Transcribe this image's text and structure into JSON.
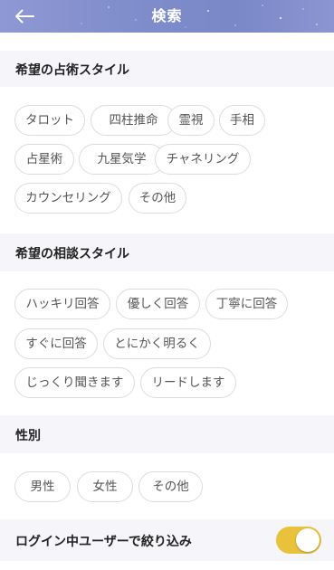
{
  "header": {
    "title": "検索",
    "back_icon": "arrow-left-icon"
  },
  "sections": [
    {
      "title": "希望の占術スタイル",
      "options": [
        "タロット",
        "四柱推命",
        "霊視",
        "手相",
        "占星術",
        "九星気学",
        "チャネリング",
        "カウンセリング",
        "その他"
      ]
    },
    {
      "title": "希望の相談スタイル",
      "options": [
        "ハッキリ回答",
        "優しく回答",
        "丁寧に回答",
        "すぐに回答",
        "とにかく明るく",
        "じっくり聞きます",
        "リードします"
      ]
    },
    {
      "title": "性別",
      "options": [
        "男性",
        "女性",
        "その他"
      ]
    }
  ],
  "filter": {
    "label": "ログイン中ユーザーで絞り込み",
    "enabled": true
  },
  "colors": {
    "accent": "#e8c23a",
    "header": "#7e8ccb",
    "section_bg": "#f6f6fa"
  }
}
